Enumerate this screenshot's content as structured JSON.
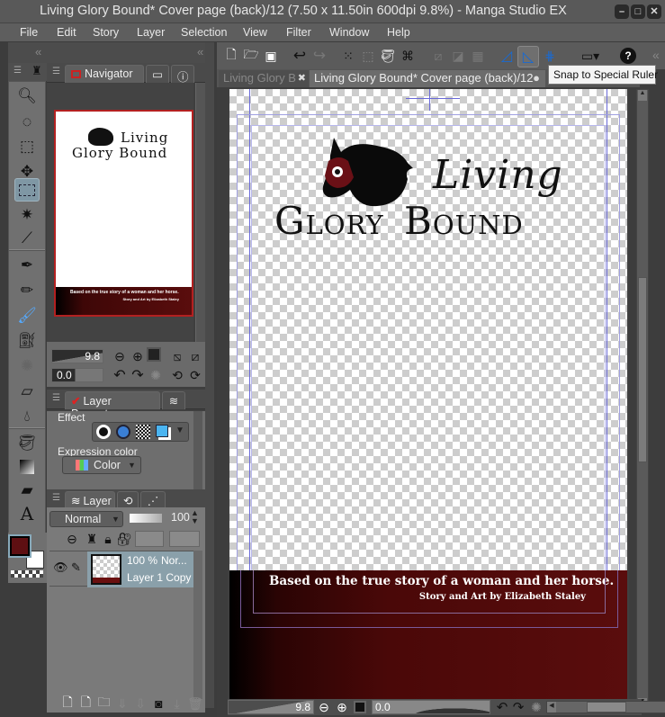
{
  "window": {
    "title": "Living Glory Bound* Cover page (back)/12 (7.50 x 11.50in 600dpi 9.8%)  - Manga Studio EX",
    "controls": [
      "minimize",
      "maximize",
      "close"
    ]
  },
  "menu": [
    "File",
    "Edit",
    "Story",
    "Layer",
    "Selection",
    "View",
    "Filter",
    "Window",
    "Help"
  ],
  "tools": [
    {
      "name": "zoom",
      "icon": "magnifier-icon"
    },
    {
      "name": "rotate",
      "icon": "rotate-icon"
    },
    {
      "name": "object",
      "icon": "object-icon"
    },
    {
      "name": "move",
      "icon": "move-icon"
    },
    {
      "name": "selection",
      "icon": "rect-select-icon",
      "active": true
    },
    {
      "name": "magic-wand",
      "icon": "magic-wand-icon"
    },
    {
      "name": "eyedropper",
      "icon": "eyedropper-icon"
    },
    {
      "name": "pen",
      "icon": "pen-icon"
    },
    {
      "name": "pencil",
      "icon": "pencil-icon"
    },
    {
      "name": "brush",
      "icon": "brush-icon"
    },
    {
      "name": "airbrush",
      "icon": "airbrush-icon"
    },
    {
      "name": "decoration",
      "icon": "decoration-icon"
    },
    {
      "name": "eraser",
      "icon": "eraser-icon"
    },
    {
      "name": "blend",
      "icon": "blend-icon"
    },
    {
      "name": "fill",
      "icon": "fill-icon"
    },
    {
      "name": "gradient",
      "icon": "gradient-icon"
    },
    {
      "name": "figure",
      "icon": "figure-icon"
    },
    {
      "name": "text",
      "icon": "text-icon"
    },
    {
      "name": "operation",
      "icon": "operation-icon"
    }
  ],
  "colors": {
    "main": "#5e0f12",
    "sub": "#ffffff",
    "accent_red": "#b32020"
  },
  "navigator": {
    "tab_label": "Navigator",
    "zoom_value": "9.8",
    "rotation_value": "0.0"
  },
  "layer_property": {
    "tab_label": "Layer Property",
    "effect_label": "Effect",
    "expression_color_label": "Expression color",
    "expression_color_value": "Color"
  },
  "layer_panel": {
    "tab_label": "Layer",
    "blend_mode": "Normal",
    "opacity": "100",
    "layers": [
      {
        "opacity": "100 %",
        "mode": "Nor...",
        "name": "Layer 1 Copy"
      }
    ]
  },
  "toolbar": {
    "tooltip": "Snap to Special Ruler"
  },
  "doc_tabs": [
    {
      "label": "Living Glory B",
      "active": false
    },
    {
      "label": "Living Glory Bound* Cover page (back)/12",
      "active": true
    }
  ],
  "canvas": {
    "logo_line1": "Living",
    "logo_line2a": "Glory",
    "logo_line2b": "Bound",
    "tagline": "Based on the true story of a woman and her horse.",
    "credit": "Story and Art by Elizabeth Staley",
    "zoom_value": "9.8",
    "rotation_value": "0.0"
  }
}
